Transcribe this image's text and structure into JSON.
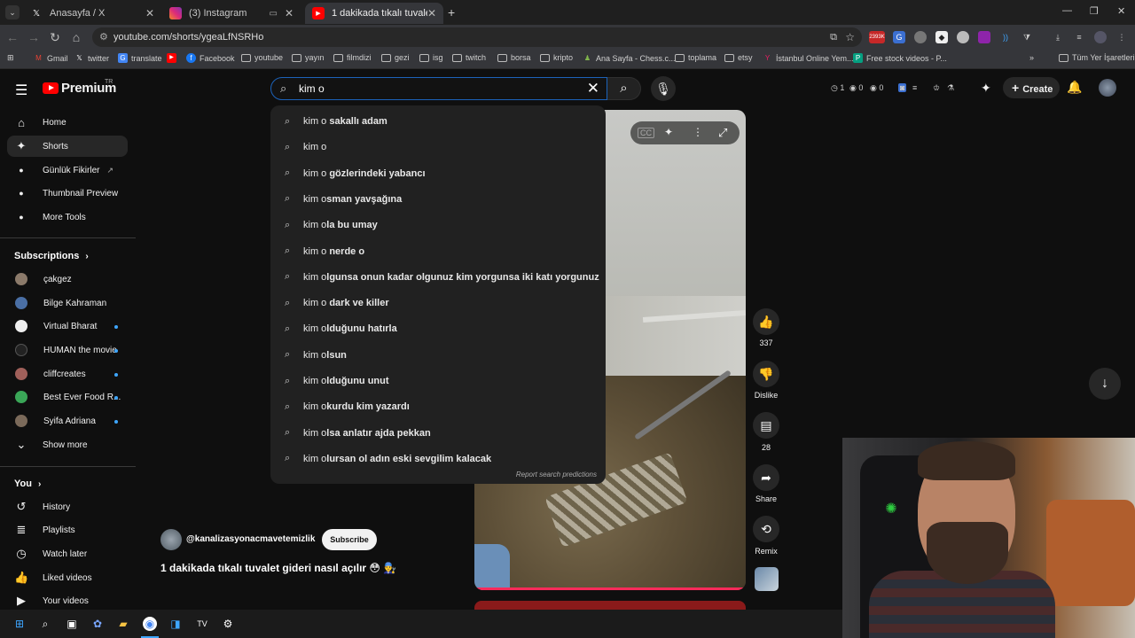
{
  "browser": {
    "tabs": [
      {
        "title": "Anasayfa / X",
        "icon": "x-icon"
      },
      {
        "title": "(3) Instagram",
        "icon": "instagram-icon"
      },
      {
        "title": "1 dakikada tıkalı tuvalet gideri",
        "icon": "youtube-icon"
      }
    ],
    "url": "youtube.com/shorts/ygeaLfNSRHo",
    "extension_badge": "2393K",
    "bookmarks": [
      "Gmail",
      "twitter",
      "translate",
      "Facebook",
      "youtube",
      "yayın",
      "filmdizi",
      "gezi",
      "isg",
      "twitch",
      "borsa",
      "kripto",
      "Ana Sayfa - Chess.c...",
      "toplama",
      "etsy",
      "İstanbul Online Yem...",
      "Free stock videos - P..."
    ],
    "all_bookmarks": "Tüm Yer İşaretleri"
  },
  "youtube": {
    "logo_text": "Premium",
    "region": "TR",
    "search_value": "kim o",
    "header_stats": [
      "1",
      "0",
      "0"
    ],
    "create_label": "Create",
    "sidebar": {
      "main": [
        "Home",
        "Shorts",
        "Günlük Fikirler",
        "Thumbnail Preview",
        "More Tools"
      ],
      "subscriptions_title": "Subscriptions",
      "subscriptions": [
        "çakgez",
        "Bilge Kahraman",
        "Virtual Bharat",
        "HUMAN the movie",
        "cliffcreates",
        "Best Ever Food R...",
        "Syifa Adriana"
      ],
      "show_more": "Show more",
      "you_title": "You",
      "you_items": [
        "History",
        "Playlists",
        "Watch later",
        "Liked videos",
        "Your videos"
      ]
    },
    "suggestions": [
      {
        "typed": "kim o",
        "rest": " sakallı adam"
      },
      {
        "typed": "kim o",
        "rest": ""
      },
      {
        "typed": "kim o",
        "rest": " gözlerindeki yabancı"
      },
      {
        "typed": "kim o",
        "rest": "sman yavşağına"
      },
      {
        "typed": "kim o",
        "rest": "la bu umay"
      },
      {
        "typed": "kim o",
        "rest": " nerde o"
      },
      {
        "typed": "kim o",
        "rest": "lgunsa onun kadar olgunuz kim yorgunsa iki katı yorgunuz"
      },
      {
        "typed": "kim o",
        "rest": " dark ve killer"
      },
      {
        "typed": "kim o",
        "rest": "lduğunu hatırla"
      },
      {
        "typed": "kim o",
        "rest": "lsun"
      },
      {
        "typed": "kim o",
        "rest": "lduğunu unut"
      },
      {
        "typed": "kim o",
        "rest": "kurdu kim yazardı"
      },
      {
        "typed": "kim o",
        "rest": "lsa anlatır ajda pekkan"
      },
      {
        "typed": "kim o",
        "rest": "lursan ol adın eski sevgilim kalacak"
      }
    ],
    "report_label": "Report search predictions",
    "actions": {
      "likes": "337",
      "dislike": "Dislike",
      "comments": "28",
      "share": "Share",
      "remix": "Remix"
    },
    "channel": "@kanalizasyonacmavetemizlik",
    "subscribe_label": "Subscribe",
    "video_title": "1 dakikada tıkalı tuvalet gideri nasıl açılır 😳 👨‍🔧"
  },
  "colors": {
    "accent": "#ff0000",
    "search_border": "#1c62b9",
    "progress": "#ff2a5a"
  }
}
